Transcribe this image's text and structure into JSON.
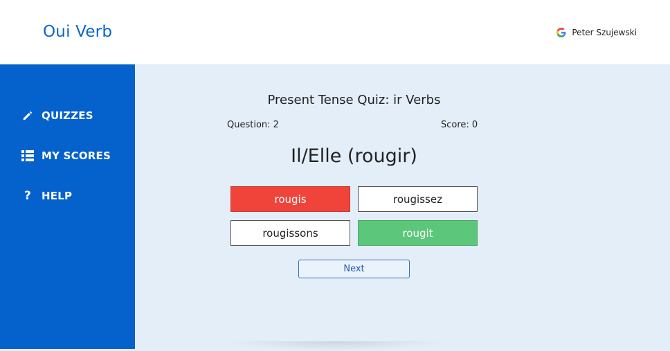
{
  "header": {
    "brand": "Oui Verb",
    "user_name": "Peter Szujewski",
    "user_icon": "google-g-icon"
  },
  "sidebar": {
    "items": [
      {
        "label": "QUIZZES",
        "icon": "pencil-icon"
      },
      {
        "label": "MY SCORES",
        "icon": "list-icon"
      },
      {
        "label": "HELP",
        "icon": "question-icon"
      }
    ]
  },
  "quiz": {
    "title": "Present Tense Quiz: ir Verbs",
    "question_label": "Question: 2",
    "score_label": "Score: 0",
    "prompt": "Il/Elle (rougir)",
    "answers": [
      {
        "label": "rougis",
        "state": "wrong"
      },
      {
        "label": "rougissez",
        "state": "neutral"
      },
      {
        "label": "rougissons",
        "state": "neutral"
      },
      {
        "label": "rougit",
        "state": "correct"
      }
    ],
    "next_label": "Next"
  },
  "colors": {
    "brand": "#0a66cc",
    "sidebar": "#0562cc",
    "wrong": "#f0443a",
    "correct": "#5cc77a",
    "background": "#e4eef8"
  }
}
